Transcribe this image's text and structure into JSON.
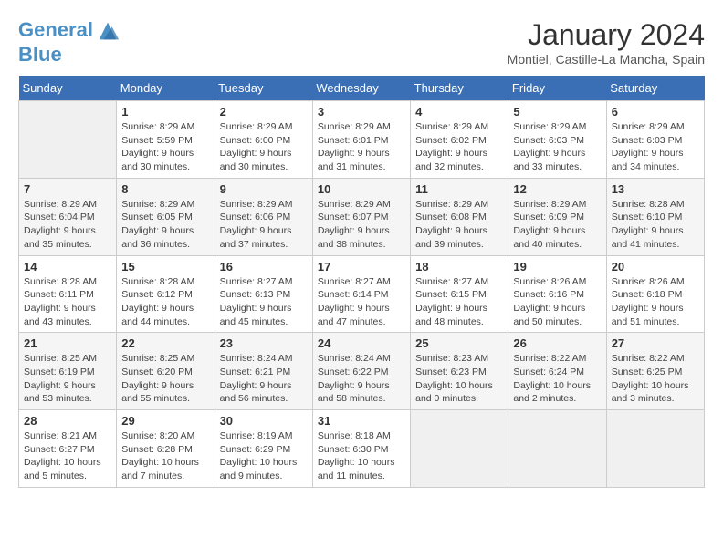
{
  "header": {
    "logo_line1": "General",
    "logo_line2": "Blue",
    "month": "January 2024",
    "location": "Montiel, Castille-La Mancha, Spain"
  },
  "days_of_week": [
    "Sunday",
    "Monday",
    "Tuesday",
    "Wednesday",
    "Thursday",
    "Friday",
    "Saturday"
  ],
  "weeks": [
    [
      {
        "day": "",
        "empty": true
      },
      {
        "day": "1",
        "sunrise": "Sunrise: 8:29 AM",
        "sunset": "Sunset: 5:59 PM",
        "daylight": "Daylight: 9 hours and 30 minutes."
      },
      {
        "day": "2",
        "sunrise": "Sunrise: 8:29 AM",
        "sunset": "Sunset: 6:00 PM",
        "daylight": "Daylight: 9 hours and 30 minutes."
      },
      {
        "day": "3",
        "sunrise": "Sunrise: 8:29 AM",
        "sunset": "Sunset: 6:01 PM",
        "daylight": "Daylight: 9 hours and 31 minutes."
      },
      {
        "day": "4",
        "sunrise": "Sunrise: 8:29 AM",
        "sunset": "Sunset: 6:02 PM",
        "daylight": "Daylight: 9 hours and 32 minutes."
      },
      {
        "day": "5",
        "sunrise": "Sunrise: 8:29 AM",
        "sunset": "Sunset: 6:03 PM",
        "daylight": "Daylight: 9 hours and 33 minutes."
      },
      {
        "day": "6",
        "sunrise": "Sunrise: 8:29 AM",
        "sunset": "Sunset: 6:03 PM",
        "daylight": "Daylight: 9 hours and 34 minutes."
      }
    ],
    [
      {
        "day": "7",
        "sunrise": "Sunrise: 8:29 AM",
        "sunset": "Sunset: 6:04 PM",
        "daylight": "Daylight: 9 hours and 35 minutes."
      },
      {
        "day": "8",
        "sunrise": "Sunrise: 8:29 AM",
        "sunset": "Sunset: 6:05 PM",
        "daylight": "Daylight: 9 hours and 36 minutes."
      },
      {
        "day": "9",
        "sunrise": "Sunrise: 8:29 AM",
        "sunset": "Sunset: 6:06 PM",
        "daylight": "Daylight: 9 hours and 37 minutes."
      },
      {
        "day": "10",
        "sunrise": "Sunrise: 8:29 AM",
        "sunset": "Sunset: 6:07 PM",
        "daylight": "Daylight: 9 hours and 38 minutes."
      },
      {
        "day": "11",
        "sunrise": "Sunrise: 8:29 AM",
        "sunset": "Sunset: 6:08 PM",
        "daylight": "Daylight: 9 hours and 39 minutes."
      },
      {
        "day": "12",
        "sunrise": "Sunrise: 8:29 AM",
        "sunset": "Sunset: 6:09 PM",
        "daylight": "Daylight: 9 hours and 40 minutes."
      },
      {
        "day": "13",
        "sunrise": "Sunrise: 8:28 AM",
        "sunset": "Sunset: 6:10 PM",
        "daylight": "Daylight: 9 hours and 41 minutes."
      }
    ],
    [
      {
        "day": "14",
        "sunrise": "Sunrise: 8:28 AM",
        "sunset": "Sunset: 6:11 PM",
        "daylight": "Daylight: 9 hours and 43 minutes."
      },
      {
        "day": "15",
        "sunrise": "Sunrise: 8:28 AM",
        "sunset": "Sunset: 6:12 PM",
        "daylight": "Daylight: 9 hours and 44 minutes."
      },
      {
        "day": "16",
        "sunrise": "Sunrise: 8:27 AM",
        "sunset": "Sunset: 6:13 PM",
        "daylight": "Daylight: 9 hours and 45 minutes."
      },
      {
        "day": "17",
        "sunrise": "Sunrise: 8:27 AM",
        "sunset": "Sunset: 6:14 PM",
        "daylight": "Daylight: 9 hours and 47 minutes."
      },
      {
        "day": "18",
        "sunrise": "Sunrise: 8:27 AM",
        "sunset": "Sunset: 6:15 PM",
        "daylight": "Daylight: 9 hours and 48 minutes."
      },
      {
        "day": "19",
        "sunrise": "Sunrise: 8:26 AM",
        "sunset": "Sunset: 6:16 PM",
        "daylight": "Daylight: 9 hours and 50 minutes."
      },
      {
        "day": "20",
        "sunrise": "Sunrise: 8:26 AM",
        "sunset": "Sunset: 6:18 PM",
        "daylight": "Daylight: 9 hours and 51 minutes."
      }
    ],
    [
      {
        "day": "21",
        "sunrise": "Sunrise: 8:25 AM",
        "sunset": "Sunset: 6:19 PM",
        "daylight": "Daylight: 9 hours and 53 minutes."
      },
      {
        "day": "22",
        "sunrise": "Sunrise: 8:25 AM",
        "sunset": "Sunset: 6:20 PM",
        "daylight": "Daylight: 9 hours and 55 minutes."
      },
      {
        "day": "23",
        "sunrise": "Sunrise: 8:24 AM",
        "sunset": "Sunset: 6:21 PM",
        "daylight": "Daylight: 9 hours and 56 minutes."
      },
      {
        "day": "24",
        "sunrise": "Sunrise: 8:24 AM",
        "sunset": "Sunset: 6:22 PM",
        "daylight": "Daylight: 9 hours and 58 minutes."
      },
      {
        "day": "25",
        "sunrise": "Sunrise: 8:23 AM",
        "sunset": "Sunset: 6:23 PM",
        "daylight": "Daylight: 10 hours and 0 minutes."
      },
      {
        "day": "26",
        "sunrise": "Sunrise: 8:22 AM",
        "sunset": "Sunset: 6:24 PM",
        "daylight": "Daylight: 10 hours and 2 minutes."
      },
      {
        "day": "27",
        "sunrise": "Sunrise: 8:22 AM",
        "sunset": "Sunset: 6:25 PM",
        "daylight": "Daylight: 10 hours and 3 minutes."
      }
    ],
    [
      {
        "day": "28",
        "sunrise": "Sunrise: 8:21 AM",
        "sunset": "Sunset: 6:27 PM",
        "daylight": "Daylight: 10 hours and 5 minutes."
      },
      {
        "day": "29",
        "sunrise": "Sunrise: 8:20 AM",
        "sunset": "Sunset: 6:28 PM",
        "daylight": "Daylight: 10 hours and 7 minutes."
      },
      {
        "day": "30",
        "sunrise": "Sunrise: 8:19 AM",
        "sunset": "Sunset: 6:29 PM",
        "daylight": "Daylight: 10 hours and 9 minutes."
      },
      {
        "day": "31",
        "sunrise": "Sunrise: 8:18 AM",
        "sunset": "Sunset: 6:30 PM",
        "daylight": "Daylight: 10 hours and 11 minutes."
      },
      {
        "day": "",
        "empty": true
      },
      {
        "day": "",
        "empty": true
      },
      {
        "day": "",
        "empty": true
      }
    ]
  ]
}
